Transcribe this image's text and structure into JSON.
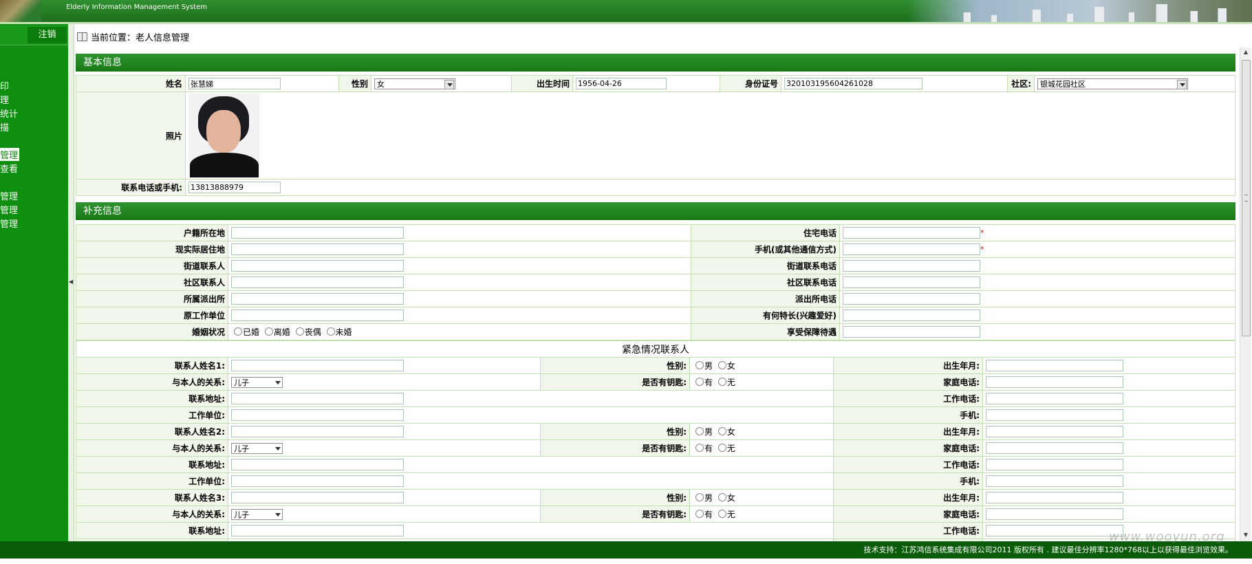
{
  "header": {
    "system_name_en": "Elderly Information Management System"
  },
  "sidebar": {
    "logout_label": "注销",
    "items": [
      {
        "label": "印",
        "active": false
      },
      {
        "label": "理",
        "active": false
      },
      {
        "label": "统计",
        "active": false
      },
      {
        "label": "描",
        "active": false
      },
      {
        "label": "管理",
        "active": true
      },
      {
        "label": "查看",
        "active": false
      },
      {
        "label": "管理",
        "active": false
      },
      {
        "label": "管理",
        "active": false
      },
      {
        "label": "管理",
        "active": false
      }
    ]
  },
  "breadcrumb": {
    "prefix": "当前位置：",
    "page": "老人信息管理"
  },
  "basic": {
    "section_title": "基本信息",
    "name_label": "姓名",
    "name_value": "张慧娣",
    "gender_label": "性别",
    "gender_value": "女",
    "birth_label": "出生时间",
    "birth_value": "1956-04-26",
    "id_label": "身份证号",
    "id_value": "320103195604261028",
    "community_label": "社区:",
    "community_value": "银城花园社区",
    "photo_label": "照片",
    "phone_label": "联系电话或手机:",
    "phone_value": "13813888979"
  },
  "extra": {
    "section_title": "补充信息",
    "rows": [
      {
        "left": "户籍所在地",
        "right": "住宅电话",
        "required": true
      },
      {
        "left": "现实际居住地",
        "right": "手机(或其他通信方式)",
        "required": true
      },
      {
        "left": "街道联系人",
        "right": "街道联系电话",
        "required": false
      },
      {
        "left": "社区联系人",
        "right": "社区联系电话",
        "required": false
      },
      {
        "left": "所属派出所",
        "right": "派出所电话",
        "required": false
      },
      {
        "left": "原工作单位",
        "right": "有何特长(兴趣爱好)",
        "required": false
      }
    ],
    "marital_label": "婚姻状况",
    "marital_options": [
      "已婚",
      "离婚",
      "丧偶",
      "未婚"
    ],
    "benefit_label": "享受保障待遇",
    "required_mark": "*"
  },
  "emergency": {
    "title": "紧急情况联系人",
    "gender_label": "性别:",
    "gender_options": [
      "男",
      "女"
    ],
    "birth_label": "出生年月:",
    "relation_label": "与本人的关系:",
    "relation_value": "儿子",
    "key_label": "是否有钥匙:",
    "key_options": [
      "有",
      "无"
    ],
    "home_phone_label": "家庭电话:",
    "address_label": "联系地址:",
    "work_phone_label": "工作电话:",
    "work_unit_label": "工作单位:",
    "mobile_label": "手机:",
    "contacts": [
      {
        "name_label": "联系人姓名1:"
      },
      {
        "name_label": "联系人姓名2:"
      },
      {
        "name_label": "联系人姓名3:"
      }
    ]
  },
  "footer": {
    "text": "技术支持：江苏鸿信系统集成有限公司2011 版权所有 . 建议最佳分辨率1280*768以上以获得最佳浏览效果。"
  },
  "watermark": "www.wooyun.org"
}
